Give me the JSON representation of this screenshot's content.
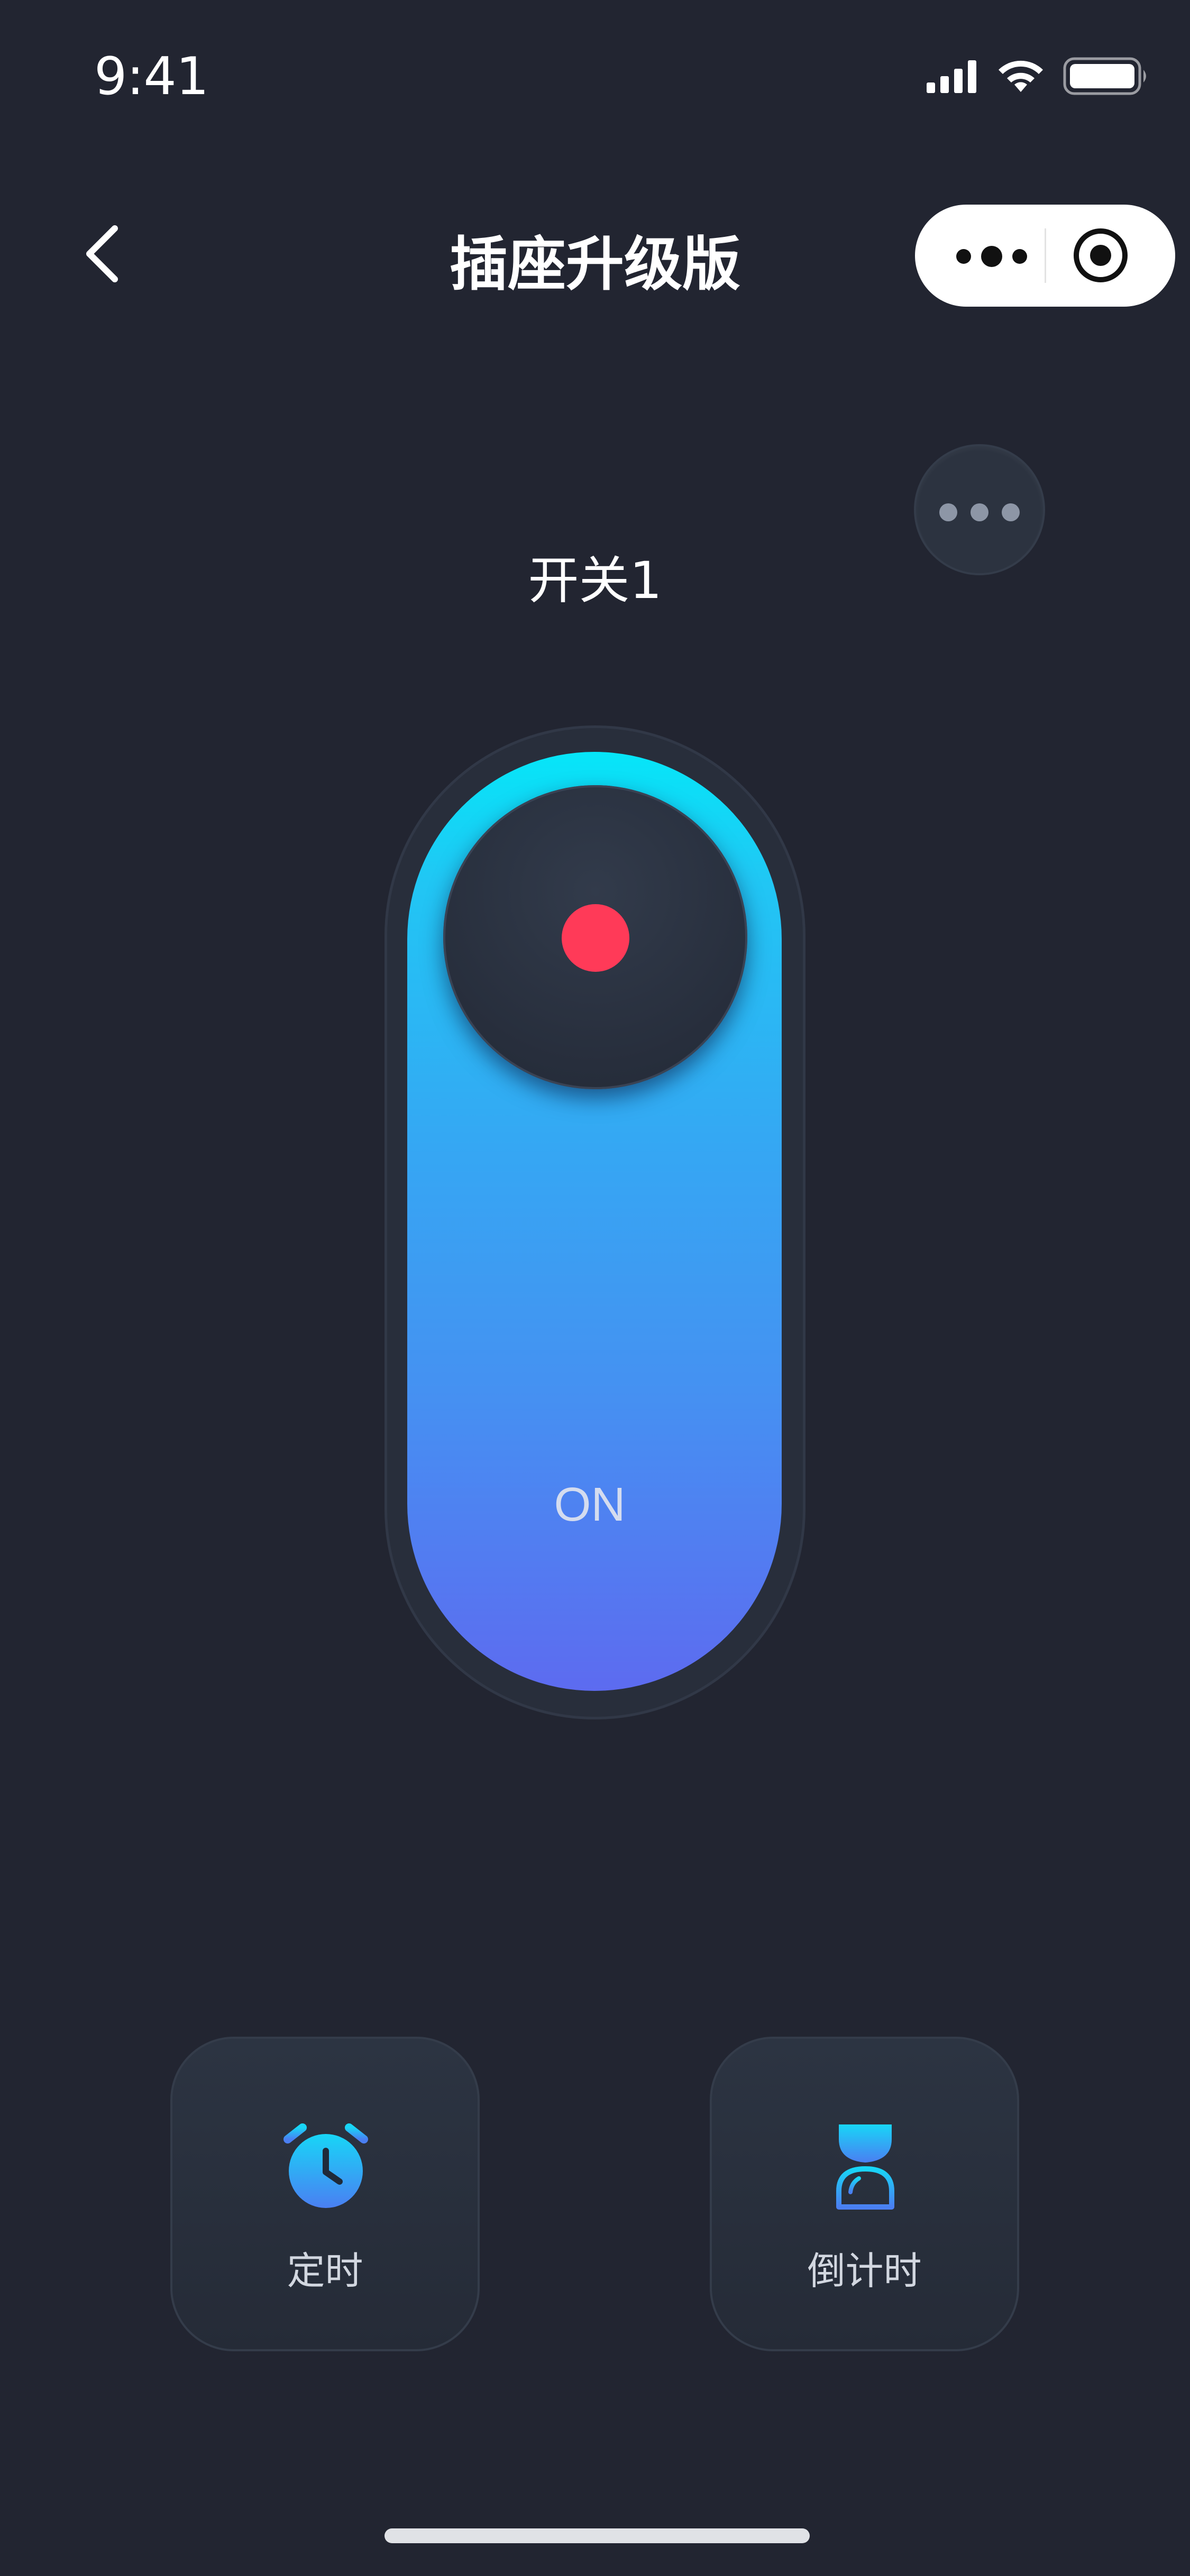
{
  "status_bar": {
    "time": "9:41"
  },
  "nav": {
    "title": "插座升级版"
  },
  "device": {
    "switch_name": "开关1",
    "state_label": "ON"
  },
  "actions": [
    {
      "label": "定时",
      "icon": "alarm-clock-icon"
    },
    {
      "label": "倒计时",
      "icon": "hourglass-icon"
    }
  ],
  "colors": {
    "background": "#222531",
    "toggle_gradient_top": "#06e6f8",
    "toggle_gradient_bottom": "#5d6bf0",
    "indicator_dot": "#ff3a58"
  }
}
